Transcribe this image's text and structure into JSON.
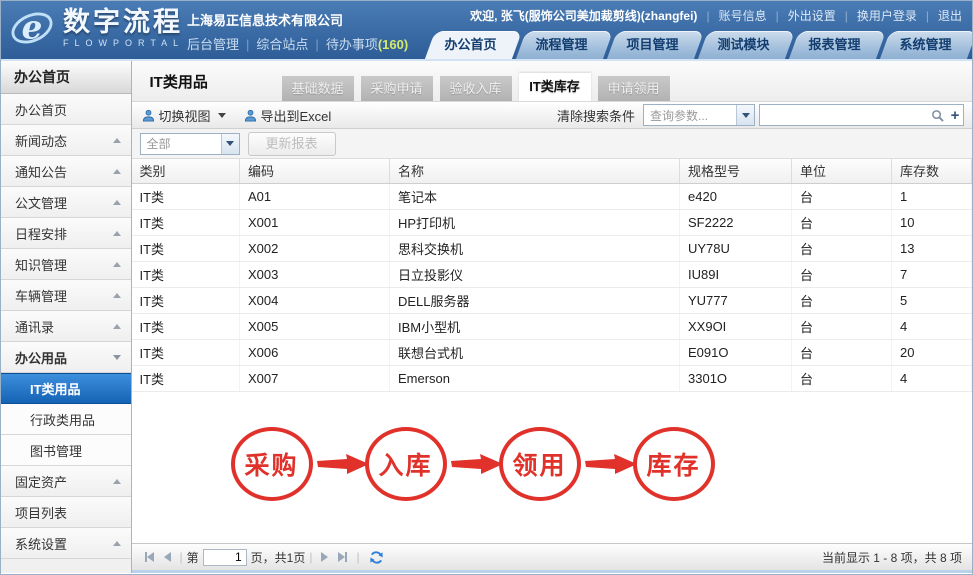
{
  "colors": {
    "header_blue_top": "#4a7cb5",
    "header_blue_bottom": "#2e5d98",
    "accent_red": "#e0322a",
    "selected_blue_top": "#3e8ede",
    "selected_blue_bottom": "#1463b4",
    "todo_count_green": "#d6e86a",
    "tab_text_navy": "#123d6f"
  },
  "brand": {
    "logo_cn": "数字流程",
    "logo_en": "FLOWPORTAL",
    "company": "上海易正信息技术有限公司",
    "quick_links": [
      "后台管理",
      "综合站点",
      "待办事项"
    ],
    "todo_count": "(160)"
  },
  "user_bar": {
    "welcome": "欢迎, 张飞(服饰公司美加裁剪线)(zhangfei)",
    "links": [
      "账号信息",
      "外出设置",
      "换用户登录",
      "退出"
    ]
  },
  "main_tabs": [
    {
      "label": "办公首页",
      "active": true
    },
    {
      "label": "流程管理",
      "active": false
    },
    {
      "label": "项目管理",
      "active": false
    },
    {
      "label": "测试模块",
      "active": false
    },
    {
      "label": "报表管理",
      "active": false
    },
    {
      "label": "系统管理",
      "active": false
    }
  ],
  "sidebar": {
    "header": "办公首页",
    "items": [
      {
        "label": "办公首页",
        "arrow": "none",
        "type": "item",
        "selected": false
      },
      {
        "label": "新闻动态",
        "arrow": "up",
        "type": "item",
        "selected": false
      },
      {
        "label": "通知公告",
        "arrow": "up",
        "type": "item",
        "selected": false
      },
      {
        "label": "公文管理",
        "arrow": "up",
        "type": "item",
        "selected": false
      },
      {
        "label": "日程安排",
        "arrow": "up",
        "type": "item",
        "selected": false
      },
      {
        "label": "知识管理",
        "arrow": "up",
        "type": "item",
        "selected": false
      },
      {
        "label": "车辆管理",
        "arrow": "up",
        "type": "item",
        "selected": false
      },
      {
        "label": "通讯录",
        "arrow": "up",
        "type": "item",
        "selected": false
      },
      {
        "label": "办公用品",
        "arrow": "down",
        "type": "group",
        "selected": false
      },
      {
        "label": "IT类用品",
        "arrow": "none",
        "type": "sub",
        "selected": true
      },
      {
        "label": "行政类用品",
        "arrow": "none",
        "type": "sub",
        "selected": false
      },
      {
        "label": "图书管理",
        "arrow": "none",
        "type": "sub",
        "selected": false
      },
      {
        "label": "固定资产",
        "arrow": "up",
        "type": "item",
        "selected": false
      },
      {
        "label": "项目列表",
        "arrow": "none",
        "type": "item",
        "selected": false
      },
      {
        "label": "系统设置",
        "arrow": "up",
        "type": "item",
        "selected": false
      }
    ]
  },
  "content": {
    "page_title": "IT类用品",
    "sub_tabs": [
      {
        "label": "基础数据",
        "active": false
      },
      {
        "label": "采购申请",
        "active": false
      },
      {
        "label": "验收入库",
        "active": false
      },
      {
        "label": "IT类库存",
        "active": true
      },
      {
        "label": "申请领用",
        "active": false
      }
    ],
    "toolbar": {
      "switch_view": "切换视图",
      "export_excel": "导出到Excel",
      "clear_search": "清除搜索条件",
      "query_param_placeholder": "查询参数...",
      "search_value": ""
    },
    "filter": {
      "category_selected": "全部",
      "update_report": "更新报表"
    },
    "table": {
      "columns": [
        "类别",
        "编码",
        "名称",
        "规格型号",
        "单位",
        "库存数"
      ],
      "rows": [
        [
          "IT类",
          "A01",
          "笔记本",
          "e420",
          "台",
          "1"
        ],
        [
          "IT类",
          "X001",
          "HP打印机",
          "SF2222",
          "台",
          "10"
        ],
        [
          "IT类",
          "X002",
          "思科交换机",
          "UY78U",
          "台",
          "13"
        ],
        [
          "IT类",
          "X003",
          "日立投影仪",
          "IU89I",
          "台",
          "7"
        ],
        [
          "IT类",
          "X004",
          "DELL服务器",
          "YU777",
          "台",
          "5"
        ],
        [
          "IT类",
          "X005",
          "IBM小型机",
          "XX9OI",
          "台",
          "4"
        ],
        [
          "IT类",
          "X006",
          "联想台式机",
          "E091O",
          "台",
          "20"
        ],
        [
          "IT类",
          "X007",
          "Emerson",
          "3301O",
          "台",
          "4"
        ]
      ]
    },
    "flow_steps": [
      "采购",
      "入库",
      "领用",
      "库存"
    ],
    "pagination": {
      "prefix": "第",
      "page_value": "1",
      "suffix": "页，共1页",
      "summary": "当前显示 1 - 8 项，共 8 项"
    }
  }
}
